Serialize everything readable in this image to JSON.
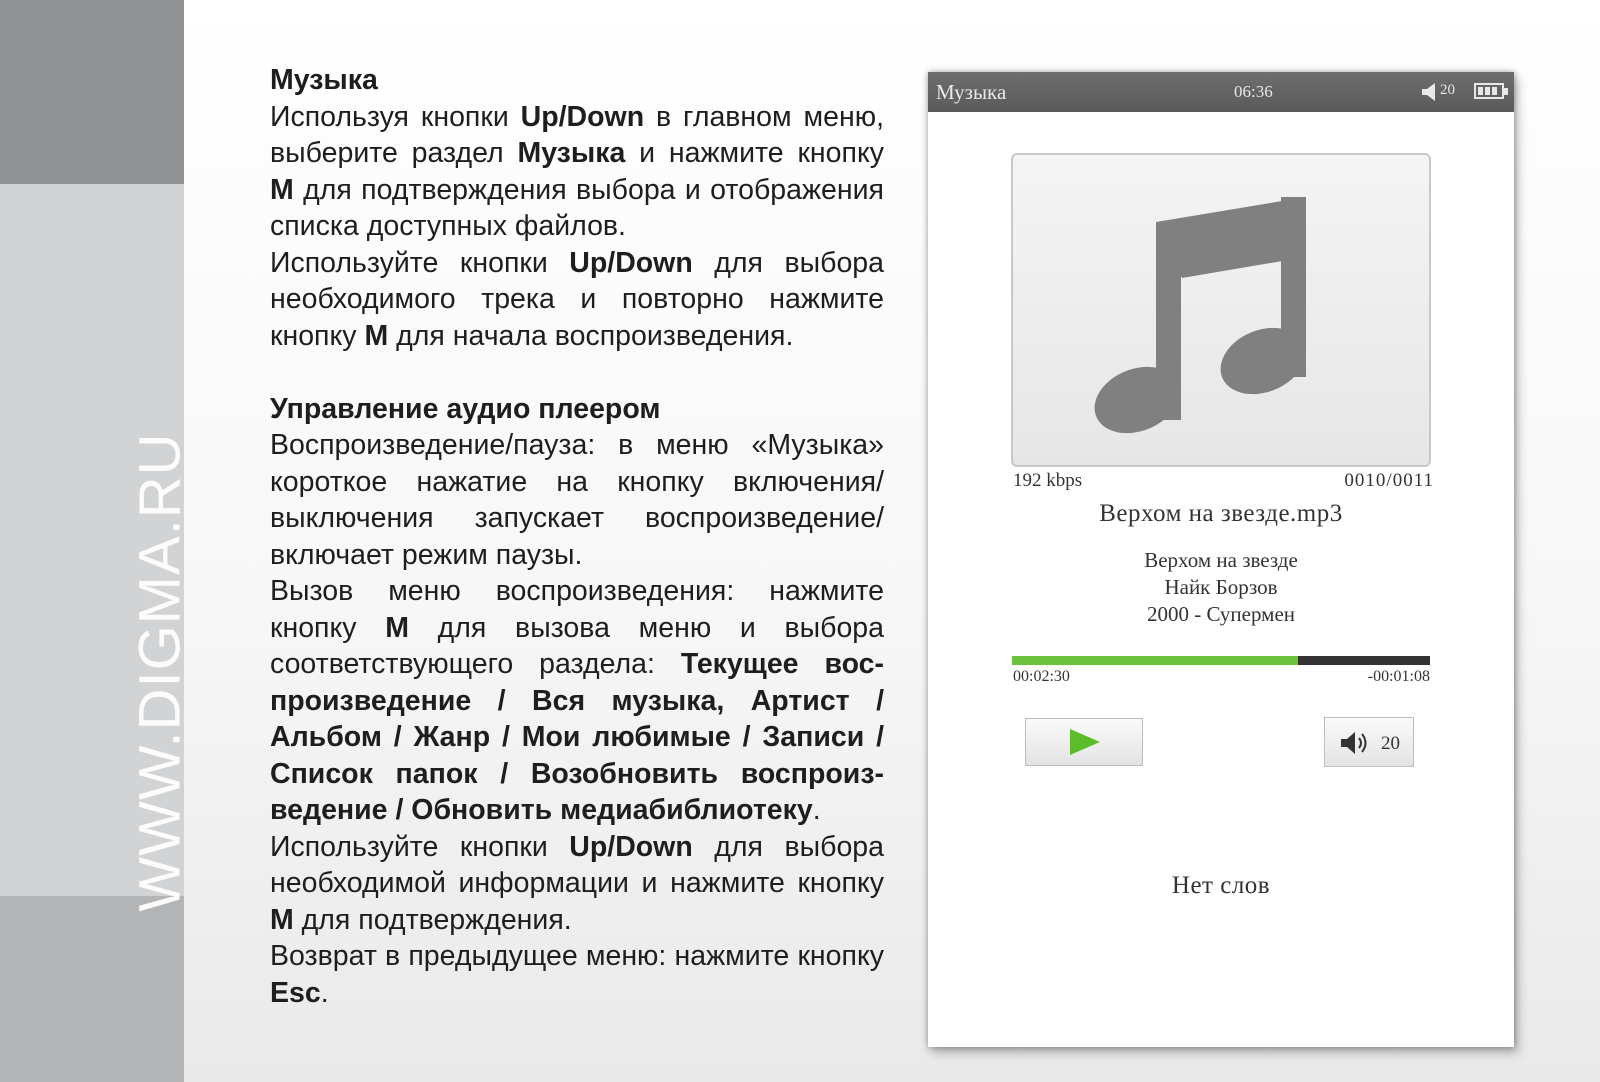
{
  "watermark": "WWW.DIGMA.RU",
  "doc": {
    "s1_title": "Музыка",
    "s1_p1": [
      {
        "t": "Используя кнопки ",
        "b": false
      },
      {
        "t": "Up/Down",
        "b": true
      },
      {
        "t": " в главном меню, выберите раздел ",
        "b": false
      },
      {
        "t": "Музыка",
        "b": true
      },
      {
        "t": " и нажмите кнопку ",
        "b": false
      },
      {
        "t": "M",
        "b": true
      },
      {
        "t": " для подтверждения выбора и отображения списка доступных файлов.",
        "b": false
      }
    ],
    "s1_p2": [
      {
        "t": "Используйте кнопки ",
        "b": false
      },
      {
        "t": "Up/Down",
        "b": true
      },
      {
        "t": " для выбора необходимого трека и повторно нажмите кнопку ",
        "b": false
      },
      {
        "t": "M",
        "b": true
      },
      {
        "t": " для начала воспроизведения.",
        "b": false
      }
    ],
    "s2_title": "Управление аудио плеером",
    "s2_p1": [
      {
        "t": "Воспроизведение/пауза: в меню «Музыка» короткое нажатие на кнопку включения/ выключения запускает воспроизведение/ включает режим паузы.",
        "b": false
      }
    ],
    "s2_p2": [
      {
        "t": "Вызов меню воспроизведения: нажмите кнопку ",
        "b": false
      },
      {
        "t": "M",
        "b": true
      },
      {
        "t": " для вызова меню и выбора соответствующего раздела: ",
        "b": false
      },
      {
        "t": "Текущее вос-произведение / Вся музыка, Артист / Альбом / Жанр / Мои любимые / Записи / Список папок / Возобновить воспроиз-ведение / Обновить медиабиблиотеку",
        "b": true
      },
      {
        "t": ".",
        "b": false
      }
    ],
    "s2_p3": [
      {
        "t": "Используйте кнопки ",
        "b": false
      },
      {
        "t": "Up/Down",
        "b": true
      },
      {
        "t": " для выбора необходимой информации и нажмите кнопку ",
        "b": false
      },
      {
        "t": "M",
        "b": true
      },
      {
        "t": " для подтверждения.",
        "b": false
      }
    ],
    "s2_p4": [
      {
        "t": "Возврат в предыдущее меню: нажмите кнопку ",
        "b": false
      },
      {
        "t": "Esc",
        "b": true
      },
      {
        "t": ".",
        "b": false
      }
    ]
  },
  "player": {
    "status_title": "Музыка",
    "clock": "06:36",
    "volume_level": "20",
    "bitrate": "192 kbps",
    "track_index": "0010/0011",
    "filename": "Верхом на звезде.mp3",
    "song_title": "Верхом на звезде",
    "artist": "Найк Борзов",
    "album": "2000 - Супермен",
    "progress_fraction": 0.685,
    "elapsed": "00:02:30",
    "remaining": "-00:01:08",
    "volume_button_value": "20",
    "lyrics_text": "Нет слов",
    "accent_color": "#6cc23a",
    "icons": [
      "music-note-icon",
      "play-icon",
      "speaker-icon",
      "battery-icon"
    ]
  }
}
